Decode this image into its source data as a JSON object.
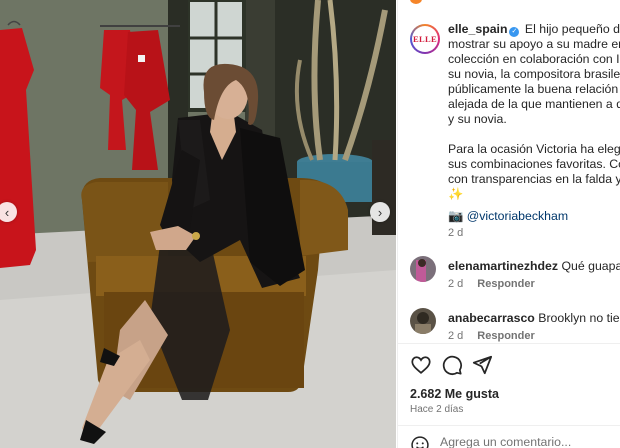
{
  "photo": {
    "alt_subject": "photo-post",
    "nav_left_icon": "chevron-left-icon",
    "nav_right_icon": "chevron-right-icon"
  },
  "post": {
    "account": "elle_spain",
    "avatar_text": "ELLE",
    "verified": true,
    "caption": " El hijo pequeño de los\nmostrar su apoyo a su madre en la p\ncolección en colaboración con Isa G\nsu novia, la compositora brasileña Ja\npúblicamente la buena relación que\nalejada de la que mantienen a día d\ny su novia.\n\nPara la ocasión Victoria ha elegido u\nsus combinaciones favoritas. Compu\ncon transparencias en la falda y una\n✨",
    "mention_emoji": "📷",
    "mention": "@victoriabeckham",
    "time": "2 d"
  },
  "comments": [
    {
      "user": "elenamartinezhdez",
      "text": "Qué guapa 😍",
      "time": "2 d",
      "reply_label": "Responder",
      "like_icon": "heart-outline-icon"
    },
    {
      "user": "anabecarrasco",
      "text": "Brooklyn no tiene no",
      "time": "2 d",
      "reply_label": "Responder",
      "like_icon": "heart-outline-icon"
    }
  ],
  "actions": {
    "like_icon": "heart-outline-icon",
    "comment_icon": "comment-bubble-icon",
    "share_icon": "paper-plane-icon"
  },
  "likes": "2.682 Me gusta",
  "post_time": "Hace 2 días",
  "add_comment": {
    "icon": "emoji-smile-icon",
    "placeholder": "Agrega un comentario..."
  },
  "colors": {
    "link": "#00376b",
    "verified": "#3897f0",
    "muted": "#737373",
    "text": "#262626"
  }
}
